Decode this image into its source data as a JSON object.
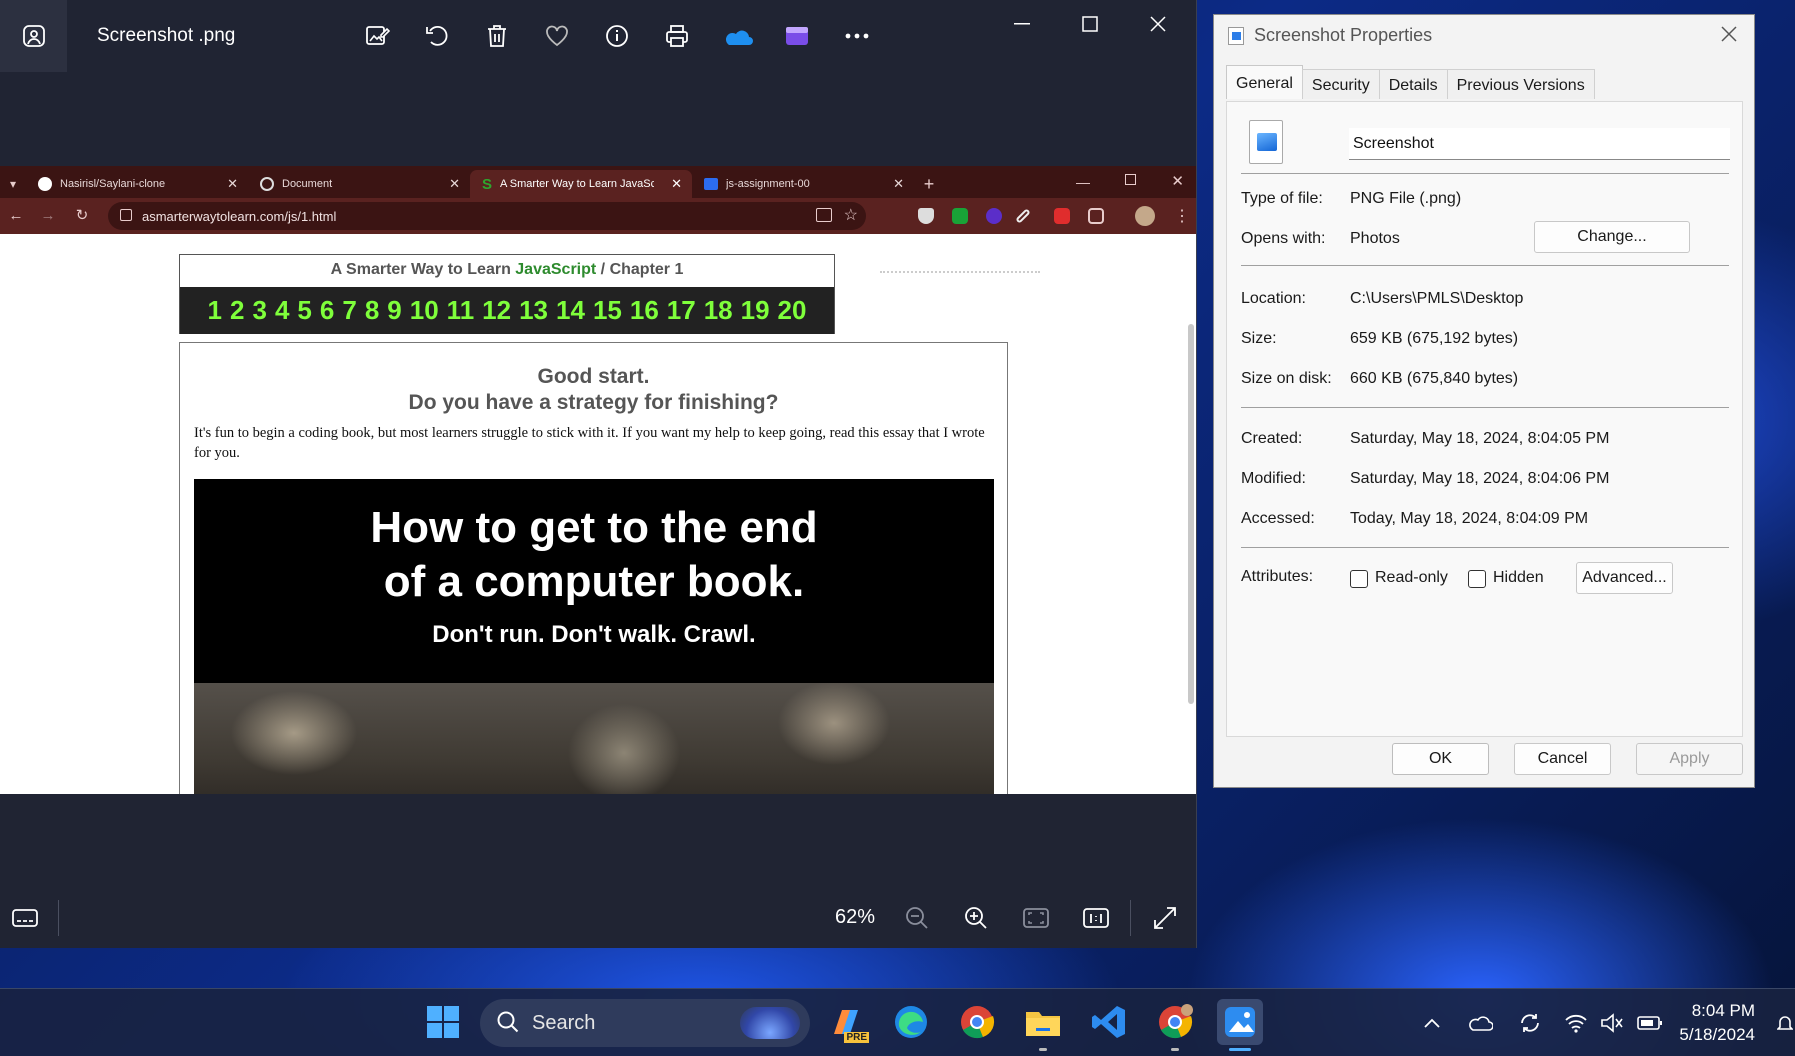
{
  "photos": {
    "title": "Screenshot .png",
    "zoom": "62%"
  },
  "chrome": {
    "tabs": [
      {
        "label": "Nasirisl/Saylani-clone"
      },
      {
        "label": "Document"
      },
      {
        "label": "A Smarter Way to Learn JavaScr"
      },
      {
        "label": "js-assignment-00"
      }
    ],
    "new_tab": "+",
    "url": "asmarterwaytolearn.com/js/1.html"
  },
  "page": {
    "header_prefix": "A Smarter Way to Learn ",
    "header_js": "JavaScript",
    "header_sep": " / ",
    "header_chapter": "Chapter 1",
    "chapters": [
      "1",
      "2",
      "3",
      "4",
      "5",
      "6",
      "7",
      "8",
      "9",
      "10",
      "11",
      "12",
      "13",
      "14",
      "15",
      "16",
      "17",
      "18",
      "19",
      "20"
    ],
    "heading1": "Good start.",
    "heading2": "Do you have a strategy for finishing?",
    "paragraph": "It's fun to begin a coding book, but most learners struggle to stick with it. If you want my help to keep going, read this essay that I wrote for you.",
    "banner_line1": "How to get to the end",
    "banner_line2": "of a computer book.",
    "banner_line3": "Don't run. Don't walk. Crawl."
  },
  "properties": {
    "title": "Screenshot  Properties",
    "tabs": [
      "General",
      "Security",
      "Details",
      "Previous Versions"
    ],
    "filename": "Screenshot",
    "rows": {
      "type_label": "Type of file:",
      "type_value": "PNG File (.png)",
      "opens_label": "Opens with:",
      "opens_value": "Photos",
      "change_btn": "Change...",
      "location_label": "Location:",
      "location_value": "C:\\Users\\PMLS\\Desktop",
      "size_label": "Size:",
      "size_value": "659 KB (675,192 bytes)",
      "disk_label": "Size on disk:",
      "disk_value": "660 KB (675,840 bytes)",
      "created_label": "Created:",
      "created_value": "Saturday, May 18, 2024, 8:04:05 PM",
      "modified_label": "Modified:",
      "modified_value": "Saturday, May 18, 2024, 8:04:06 PM",
      "accessed_label": "Accessed:",
      "accessed_value": "Today, May 18, 2024, 8:04:09 PM",
      "attr_label": "Attributes:",
      "readonly": "Read-only",
      "hidden": "Hidden",
      "advanced_btn": "Advanced..."
    },
    "ok": "OK",
    "cancel": "Cancel",
    "apply": "Apply"
  },
  "taskbar": {
    "search_placeholder": "Search",
    "time": "8:04 PM",
    "date": "5/18/2024",
    "copilot_badge": "PRE"
  }
}
